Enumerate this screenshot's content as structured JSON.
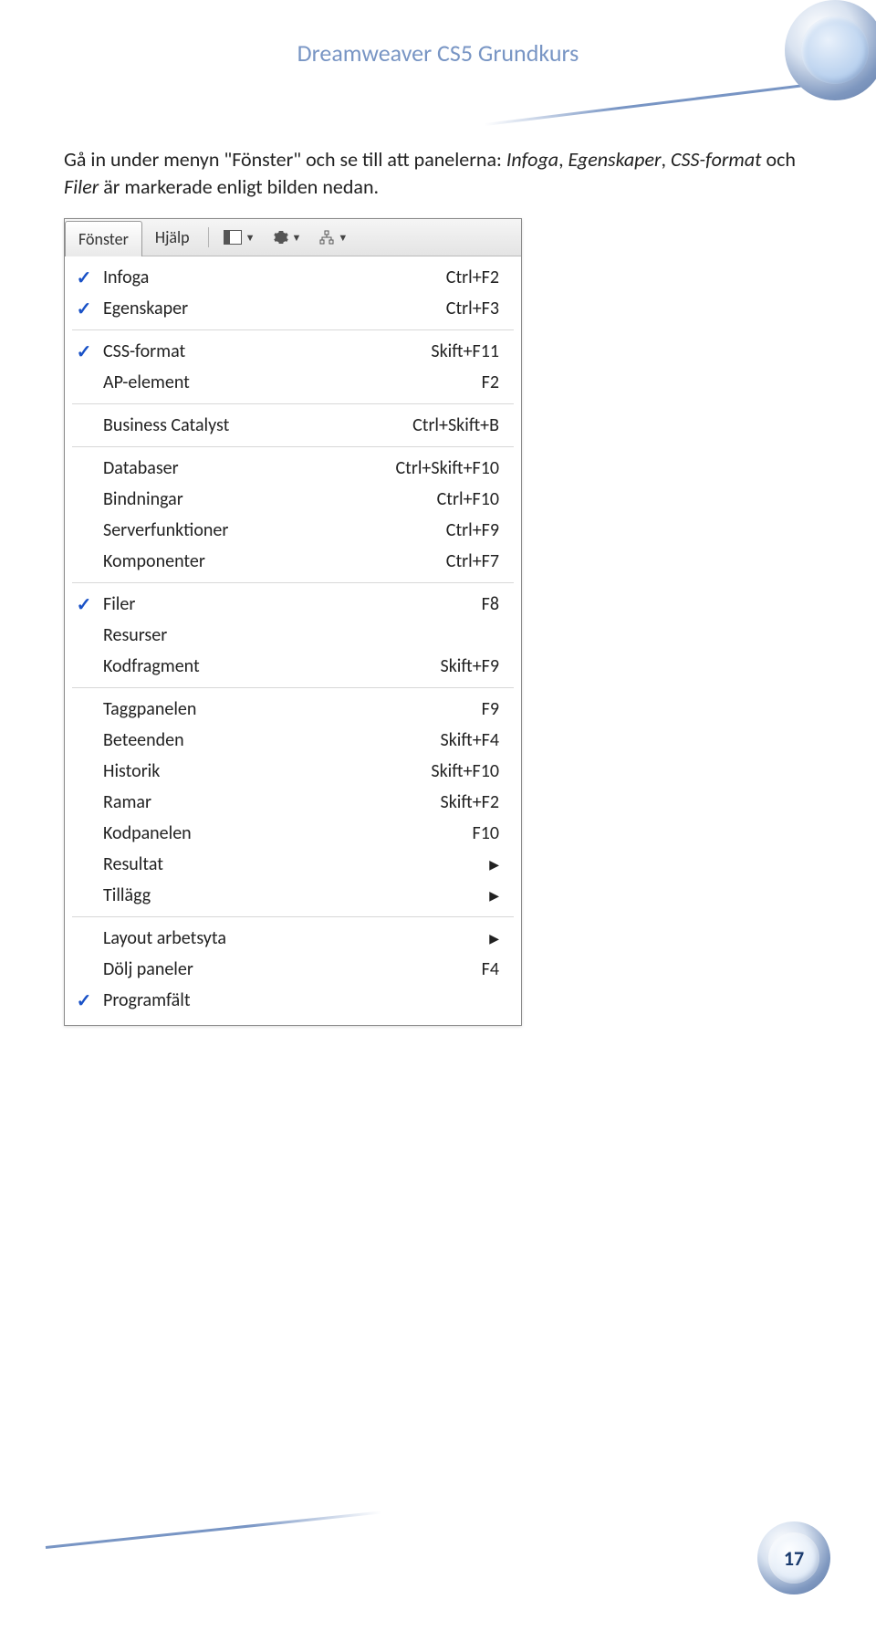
{
  "header": {
    "title": "Dreamweaver CS5 Grundkurs"
  },
  "paragraph": {
    "p1": "Gå in under menyn \"Fönster\" och se till att panelerna: ",
    "i1": "Infoga",
    "c1": ", ",
    "i2": "Egenskaper",
    "c2": ", ",
    "i3": "CSS-format",
    "p2": " och ",
    "i4": "Filer",
    "p3": " är markerade enligt bilden nedan."
  },
  "menubar": {
    "fonster": "Fönster",
    "hjalp": "Hjälp"
  },
  "menu": {
    "groups": [
      [
        {
          "label": "Infoga",
          "shortcut": "Ctrl+F2",
          "checked": true
        },
        {
          "label": "Egenskaper",
          "shortcut": "Ctrl+F3",
          "checked": true
        }
      ],
      [
        {
          "label": "CSS-format",
          "shortcut": "Skift+F11",
          "checked": true
        },
        {
          "label": "AP-element",
          "shortcut": "F2",
          "checked": false
        }
      ],
      [
        {
          "label": "Business Catalyst",
          "shortcut": "Ctrl+Skift+B",
          "checked": false
        }
      ],
      [
        {
          "label": "Databaser",
          "shortcut": "Ctrl+Skift+F10",
          "checked": false
        },
        {
          "label": "Bindningar",
          "shortcut": "Ctrl+F10",
          "checked": false
        },
        {
          "label": "Serverfunktioner",
          "shortcut": "Ctrl+F9",
          "checked": false
        },
        {
          "label": "Komponenter",
          "shortcut": "Ctrl+F7",
          "checked": false
        }
      ],
      [
        {
          "label": "Filer",
          "shortcut": "F8",
          "checked": true
        },
        {
          "label": "Resurser",
          "shortcut": "",
          "checked": false
        },
        {
          "label": "Kodfragment",
          "shortcut": "Skift+F9",
          "checked": false
        }
      ],
      [
        {
          "label": "Taggpanelen",
          "shortcut": "F9",
          "checked": false
        },
        {
          "label": "Beteenden",
          "shortcut": "Skift+F4",
          "checked": false
        },
        {
          "label": "Historik",
          "shortcut": "Skift+F10",
          "checked": false
        },
        {
          "label": "Ramar",
          "shortcut": "Skift+F2",
          "checked": false
        },
        {
          "label": "Kodpanelen",
          "shortcut": "F10",
          "checked": false
        },
        {
          "label": "Resultat",
          "shortcut": "",
          "checked": false,
          "submenu": true
        },
        {
          "label": "Tillägg",
          "shortcut": "",
          "checked": false,
          "submenu": true
        }
      ],
      [
        {
          "label": "Layout arbetsyta",
          "shortcut": "",
          "checked": false,
          "submenu": true
        },
        {
          "label": "Dölj paneler",
          "shortcut": "F4",
          "checked": false
        },
        {
          "label": "Programfält",
          "shortcut": "",
          "checked": true
        }
      ]
    ]
  },
  "page_number": "17"
}
